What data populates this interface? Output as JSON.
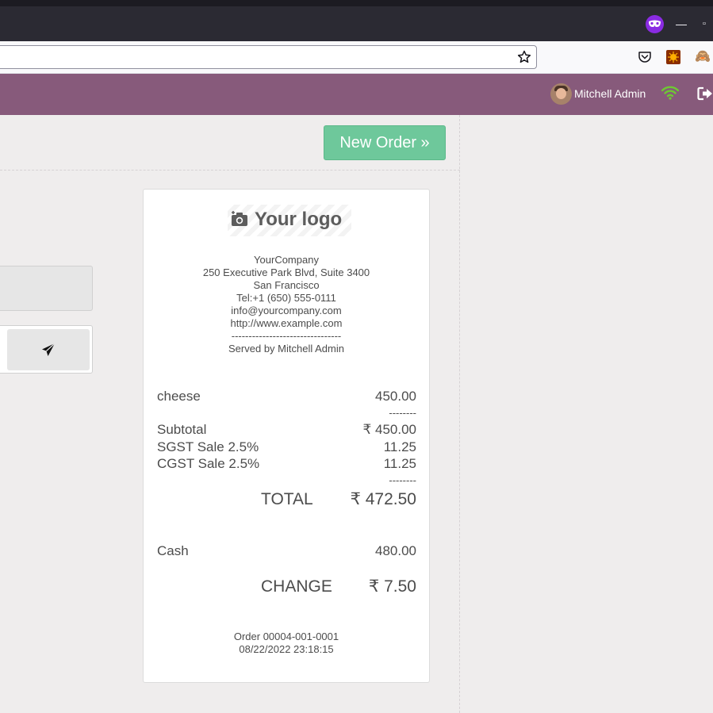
{
  "browser": {
    "icons": [
      "private-mask-icon",
      "minimize-icon",
      "maximize-icon",
      "star-icon",
      "pocket-icon",
      "extension-icon",
      "monkey-extension-icon"
    ],
    "min_glyph": "—",
    "max_glyph": "▫"
  },
  "navbar": {
    "user_name": "Mitchell Admin",
    "color": "#875a7b",
    "wifi_color": "#6ec833"
  },
  "actions": {
    "new_order_label": "New Order »",
    "new_order_color": "#6ec89b"
  },
  "receipt": {
    "logo_text": "Your logo",
    "company": "YourCompany",
    "address": "250 Executive Park Blvd, Suite 3400",
    "city": "San Francisco",
    "tel": "Tel:+1 (650) 555-0111",
    "email": "info@yourcompany.com",
    "website": "http://www.example.com",
    "separator": "--------------------------------",
    "served_by": "Served by Mitchell Admin",
    "lines": [
      {
        "name": "cheese",
        "amount": "450.00"
      }
    ],
    "short_sep": "--------",
    "subtotal_label": "Subtotal",
    "subtotal_value": "₹ 450.00",
    "taxes": [
      {
        "name": "SGST Sale 2.5%",
        "amount": "11.25"
      },
      {
        "name": "CGST Sale 2.5%",
        "amount": "11.25"
      }
    ],
    "total_label": "TOTAL",
    "total_value": "₹ 472.50",
    "payment_label": "Cash",
    "payment_value": "480.00",
    "change_label": "CHANGE",
    "change_value": "₹ 7.50",
    "order_ref": "Order 00004-001-0001",
    "order_date": "08/22/2022 23:18:15"
  }
}
